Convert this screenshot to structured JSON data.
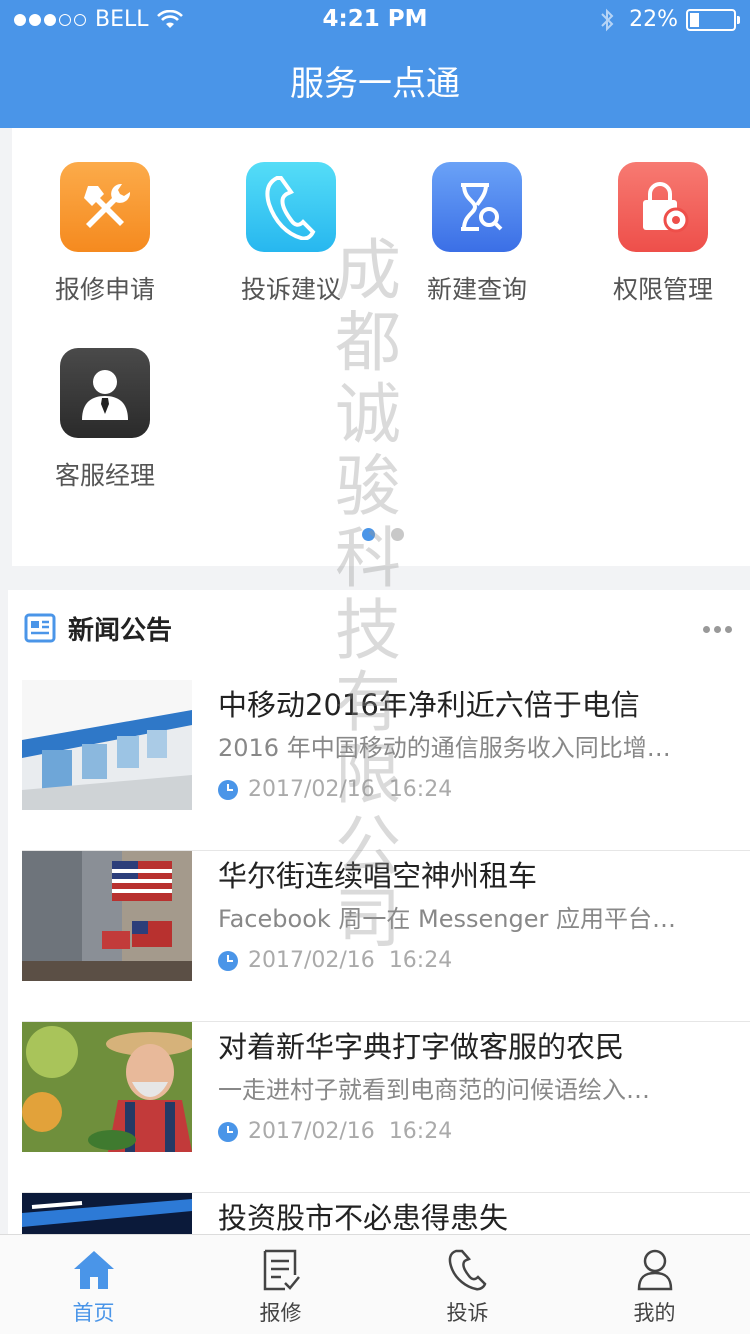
{
  "status": {
    "carrier": "BELL",
    "time": "4:21 PM",
    "battery": "22%",
    "signal_bars": 3,
    "signal_total": 5,
    "battery_level": 0.22
  },
  "nav": {
    "title": "服务一点通"
  },
  "menu": {
    "items": [
      {
        "label": "报修申请",
        "icon": "tools-icon",
        "color": "#f7982e"
      },
      {
        "label": "投诉建议",
        "icon": "phone-icon",
        "color": "#39c9f0"
      },
      {
        "label": "新建查询",
        "icon": "hourglass-search-icon",
        "color": "#4f86f0"
      },
      {
        "label": "权限管理",
        "icon": "lock-gear-icon",
        "color": "#f25f5c"
      },
      {
        "label": "客服经理",
        "icon": "manager-icon",
        "color": "#3a3a3a"
      }
    ],
    "pages": 2,
    "current_page": 1
  },
  "news": {
    "title": "新闻公告",
    "items": [
      {
        "title": "中移动2016年净利近六倍于电信",
        "summary": "2016 年中国移动的通信服务收入同比增…",
        "date": "2017/02/16",
        "time": "16:24"
      },
      {
        "title": "华尔街连续唱空神州租车",
        "summary": "Facebook 周一在 Messenger 应用平台…",
        "date": "2017/02/16",
        "time": "16:24"
      },
      {
        "title": "对着新华字典打字做客服的农民",
        "summary": "一走进村子就看到电商范的问候语绘入…",
        "date": "2017/02/16",
        "time": "16:24"
      },
      {
        "title": "投资股市不必患得患失",
        "summary": "",
        "date": "",
        "time": ""
      }
    ]
  },
  "tabs": [
    {
      "label": "首页",
      "icon": "home-icon",
      "active": true
    },
    {
      "label": "报修",
      "icon": "repair-list-icon",
      "active": false
    },
    {
      "label": "投诉",
      "icon": "phone-icon",
      "active": false
    },
    {
      "label": "我的",
      "icon": "user-icon",
      "active": false
    }
  ],
  "watermark": [
    "成",
    "都",
    "诚",
    "骏",
    "科",
    "技",
    "有",
    "限",
    "公",
    "司"
  ],
  "colors": {
    "primary": "#4a95e8",
    "background": "#f2f3f5"
  }
}
